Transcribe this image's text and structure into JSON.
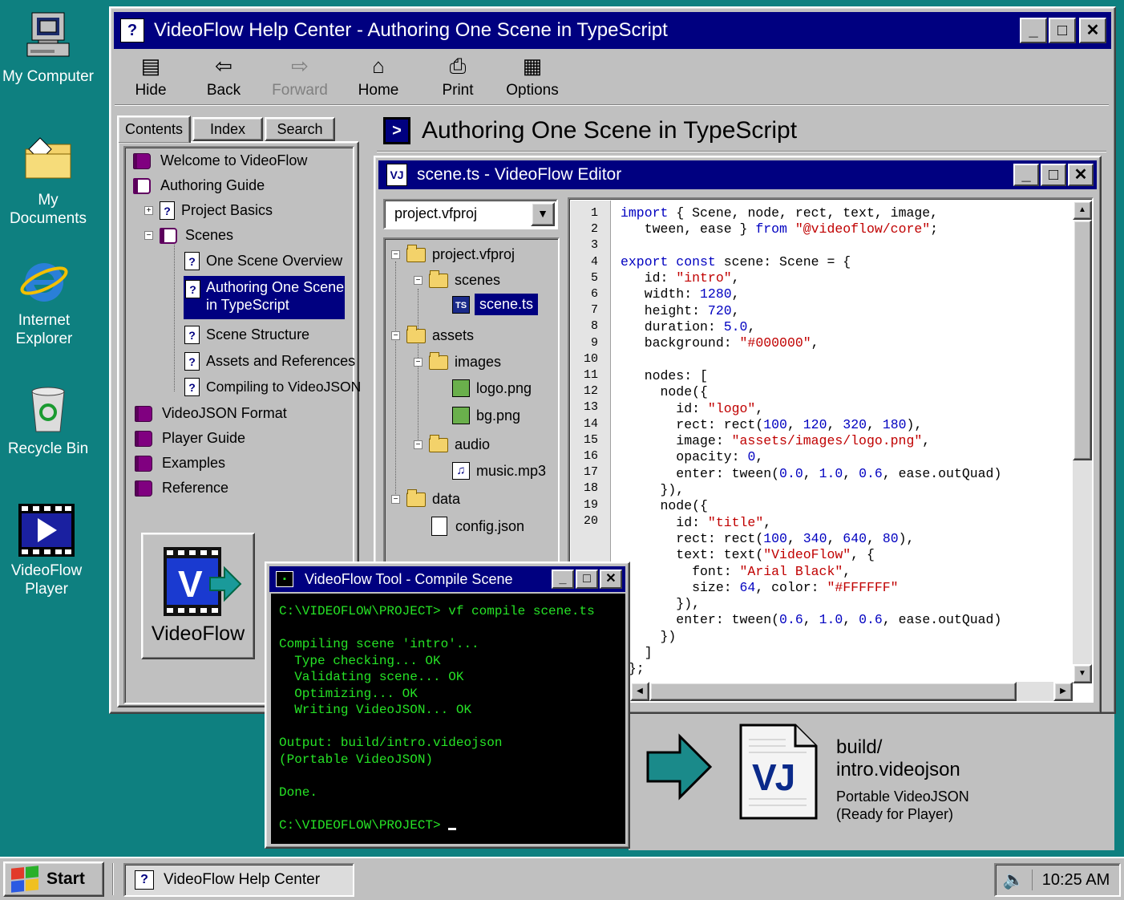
{
  "desktop": {
    "icons": [
      {
        "label": "My Computer"
      },
      {
        "label": "My Documents"
      },
      {
        "label": "Internet Explorer"
      },
      {
        "label": "Recycle Bin"
      },
      {
        "label": "VideoFlow Player"
      }
    ]
  },
  "help_window": {
    "title": "VideoFlow Help Center - Authoring One Scene in TypeScript",
    "toolbar": {
      "hide": "Hide",
      "back": "Back",
      "forward": "Forward",
      "home": "Home",
      "print": "Print",
      "options": "Options"
    },
    "tabs": {
      "contents": "Contents",
      "index": "Index",
      "search": "Search"
    },
    "toc": [
      {
        "label": "Welcome to VideoFlow"
      },
      {
        "label": "Authoring Guide"
      },
      {
        "label": "Project Basics"
      },
      {
        "label": "Scenes"
      },
      {
        "label": "One Scene Overview"
      },
      {
        "label": "Authoring One Scene",
        "label2": "in TypeScript"
      },
      {
        "label": "Scene Structure"
      },
      {
        "label": "Assets and References"
      },
      {
        "label": "Compiling to VideoJSON"
      },
      {
        "label": "VideoJSON Format"
      },
      {
        "label": "Player Guide"
      },
      {
        "label": "Examples"
      },
      {
        "label": "Reference"
      }
    ],
    "logo_text": "VideoFlow",
    "topic_title": "Authoring One Scene in TypeScript"
  },
  "editor": {
    "title": "scene.ts - VideoFlow Editor",
    "project_select": "project.vfproj",
    "tree": {
      "project": "project.vfproj",
      "scenes": "scenes",
      "scene_ts": "scene.ts",
      "assets": "assets",
      "images": "images",
      "logo": "logo.png",
      "bg": "bg.png",
      "audio": "audio",
      "music": "music.mp3",
      "data": "data",
      "config": "config.json"
    },
    "line_numbers": [
      "1",
      "2",
      "3",
      "4",
      "5",
      "6",
      "7",
      "8",
      "9",
      "10",
      "11",
      "12",
      "13",
      "14",
      "15",
      "16",
      "17",
      "18",
      "19",
      "20"
    ]
  },
  "terminal": {
    "title": "VideoFlow Tool - Compile Scene",
    "lines": [
      "C:\\VIDEOFLOW\\PROJECT> vf compile scene.ts",
      "",
      "Compiling scene 'intro'...",
      "  Type checking... OK",
      "  Validating scene... OK",
      "  Optimizing... OK",
      "  Writing VideoJSON... OK",
      "",
      "Output: build/intro.videojson",
      "(Portable VideoJSON)",
      "",
      "Done.",
      ""
    ],
    "prompt": "C:\\VIDEOFLOW\\PROJECT> "
  },
  "output_file": {
    "name1": "build/",
    "name2": "intro.videojson",
    "desc1": "Portable VideoJSON",
    "desc2": "(Ready for Player)",
    "icon_text": "VJ"
  },
  "taskbar": {
    "start": "Start",
    "task": "VideoFlow Help Center",
    "clock": "10:25 AM"
  },
  "colors": {
    "desktop": "#0e8080",
    "titlebar": "#000080",
    "terminal_text": "#26e326"
  }
}
